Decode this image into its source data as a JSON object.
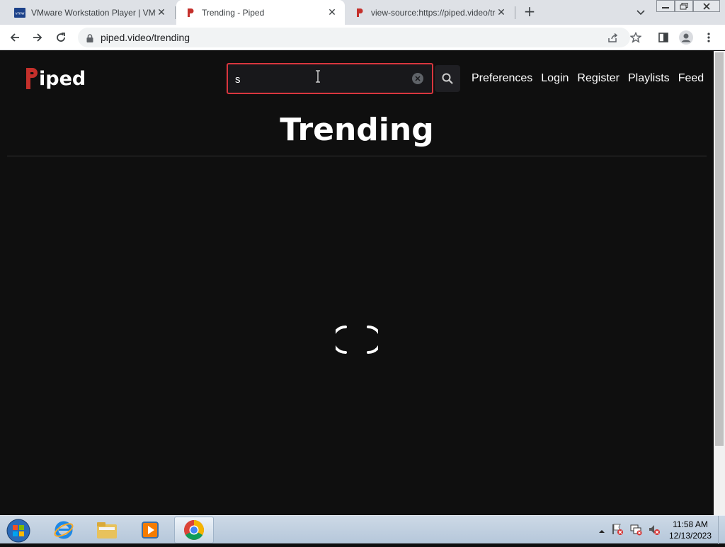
{
  "browser": {
    "tabs": [
      {
        "title": "VMware Workstation Player | VMware",
        "favicon": "vmware-icon",
        "active": false
      },
      {
        "title": "Trending - Piped",
        "favicon": "piped-icon",
        "active": true
      },
      {
        "title": "view-source:https://piped.video/trending",
        "favicon": "piped-icon",
        "active": false
      }
    ],
    "vmware_badge": "vmw",
    "url": "piped.video/trending"
  },
  "header": {
    "logo_text": "iped",
    "search_value": "s",
    "nav": [
      "Preferences",
      "Login",
      "Register",
      "Playlists",
      "Feed"
    ]
  },
  "main": {
    "title": "Trending",
    "loading": true
  },
  "taskbar": {
    "time": "11:58 AM",
    "date": "12/13/2023"
  },
  "colors": {
    "accent": "#d9363e",
    "page_bg": "#0f0f0f",
    "text": "#ffffff"
  }
}
